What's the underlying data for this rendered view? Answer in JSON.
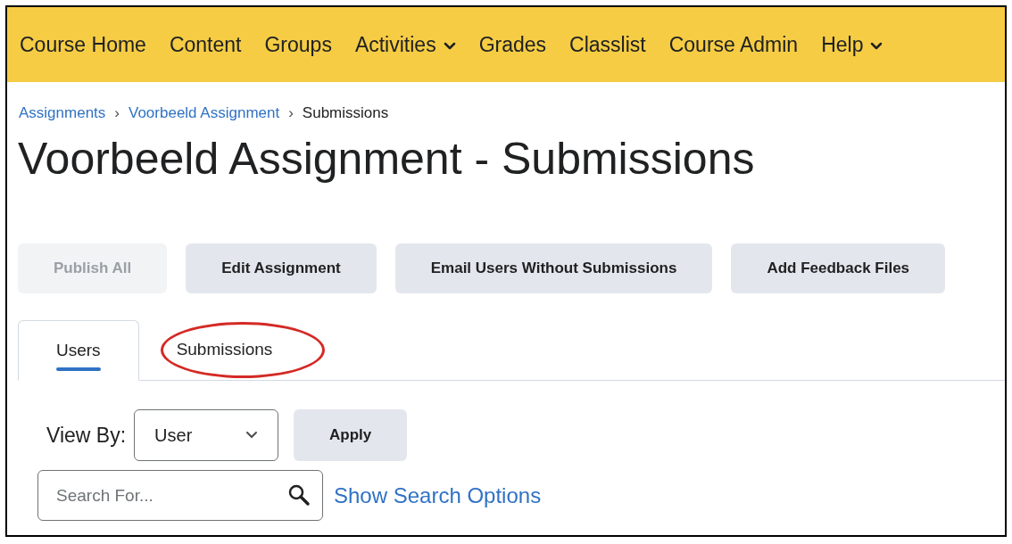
{
  "navbar": {
    "items": [
      {
        "label": "Course Home",
        "has_dropdown": false
      },
      {
        "label": "Content",
        "has_dropdown": false
      },
      {
        "label": "Groups",
        "has_dropdown": false
      },
      {
        "label": "Activities",
        "has_dropdown": true
      },
      {
        "label": "Grades",
        "has_dropdown": false
      },
      {
        "label": "Classlist",
        "has_dropdown": false
      },
      {
        "label": "Course Admin",
        "has_dropdown": false
      },
      {
        "label": "Help",
        "has_dropdown": true
      }
    ]
  },
  "breadcrumb_separator": "›",
  "breadcrumb": [
    {
      "label": "Assignments",
      "link": true
    },
    {
      "label": "Voorbeeld Assignment",
      "link": true
    },
    {
      "label": "Submissions",
      "link": false
    }
  ],
  "title": "Voorbeeld Assignment - Submissions",
  "buttons": [
    {
      "label": "Publish All",
      "disabled": true
    },
    {
      "label": "Edit Assignment",
      "disabled": false
    },
    {
      "label": "Email Users Without Submissions",
      "disabled": false
    },
    {
      "label": "Add Feedback Files",
      "disabled": false
    }
  ],
  "tabs": [
    {
      "label": "Users",
      "selected": true,
      "circled": false
    },
    {
      "label": "Submissions",
      "selected": false,
      "circled": true
    }
  ],
  "view_by": {
    "label": "View By:",
    "value": "User",
    "apply": "Apply"
  },
  "search": {
    "placeholder": "Search For...",
    "options_link": "Show Search Options"
  }
}
